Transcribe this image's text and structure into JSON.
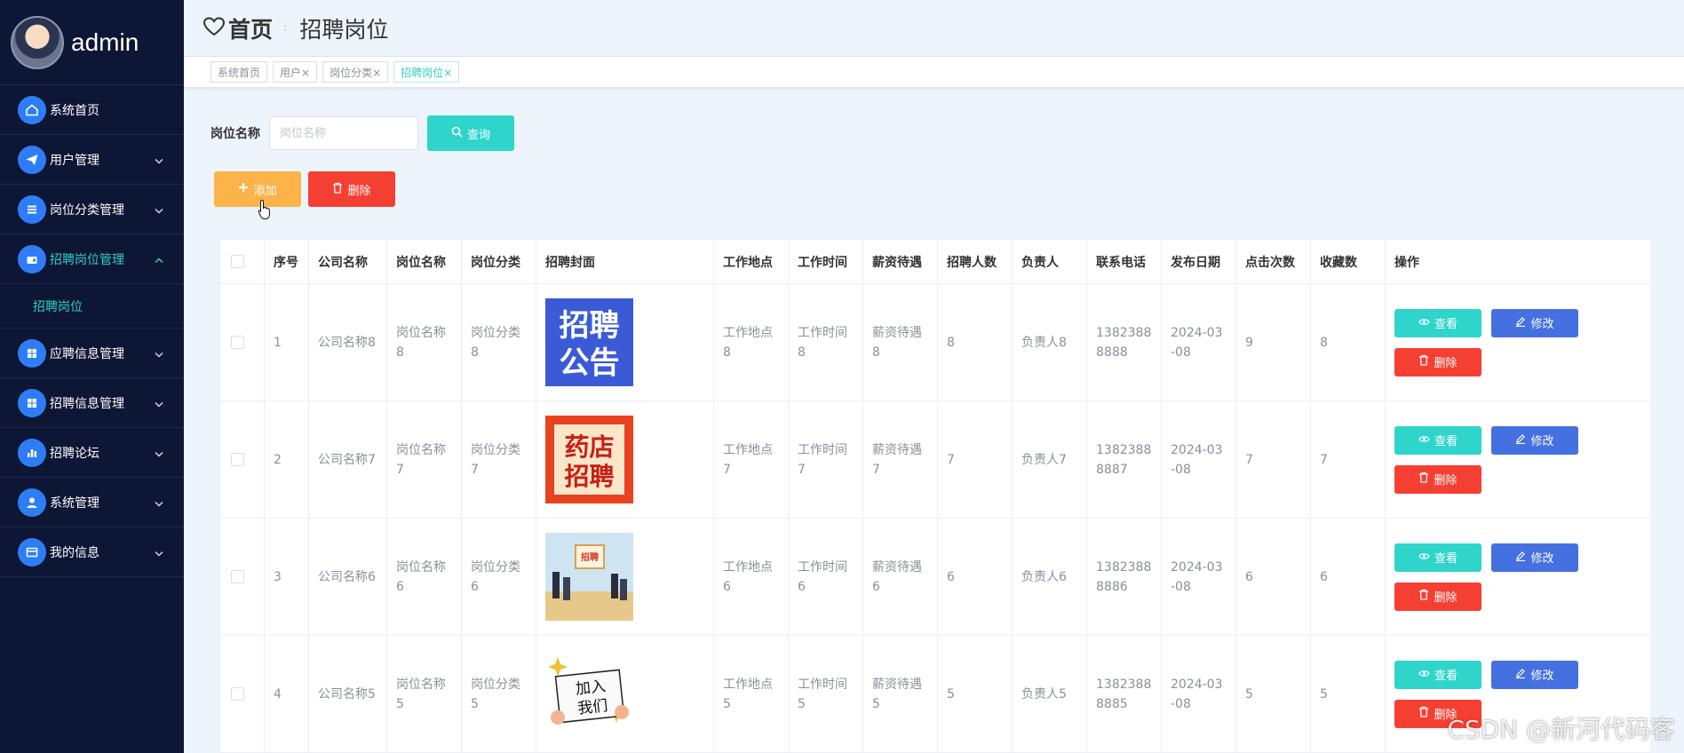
{
  "sidebar": {
    "username": "admin",
    "menu": [
      {
        "label": "系统首页",
        "icon": "home-icon"
      },
      {
        "label": "用户管理",
        "icon": "paper-plane-icon"
      },
      {
        "label": "岗位分类管理",
        "icon": "list-icon"
      },
      {
        "label": "招聘岗位管理",
        "icon": "wallet-icon"
      },
      {
        "label": "应聘信息管理",
        "icon": "grid-icon"
      },
      {
        "label": "招聘信息管理",
        "icon": "grid-icon"
      },
      {
        "label": "招聘论坛",
        "icon": "bar-chart-icon"
      },
      {
        "label": "系统管理",
        "icon": "user-icon"
      },
      {
        "label": "我的信息",
        "icon": "card-icon"
      }
    ],
    "submenu_item": "招聘岗位"
  },
  "header": {
    "home": "首页",
    "separator": ":",
    "title": "招聘岗位"
  },
  "tags": [
    {
      "label": "系统首页"
    },
    {
      "label": "用户×"
    },
    {
      "label": "岗位分类×"
    },
    {
      "label": "招聘岗位×"
    }
  ],
  "search": {
    "label": "岗位名称",
    "placeholder": "岗位名称",
    "query_button": "查询"
  },
  "actions": {
    "add": "添加",
    "delete": "删除"
  },
  "table": {
    "headers": [
      "序号",
      "公司名称",
      "岗位名称",
      "岗位分类",
      "招聘封面",
      "工作地点",
      "工作时间",
      "薪资待遇",
      "招聘人数",
      "负责人",
      "联系电话",
      "发布日期",
      "点击次数",
      "收藏数",
      "操作"
    ],
    "rows": [
      {
        "no": "1",
        "company": "公司名称8",
        "position": "岗位名称8",
        "category": "岗位分类8",
        "cover_text": [
          "招聘",
          "公告"
        ],
        "location": "工作地点8",
        "time": "工作时间8",
        "salary": "薪资待遇8",
        "count": "8",
        "manager": "负责人8",
        "phone": "13823888888",
        "date": "2024-03-08",
        "clicks": "9",
        "favorites": "8"
      },
      {
        "no": "2",
        "company": "公司名称7",
        "position": "岗位名称7",
        "category": "岗位分类7",
        "cover_text": [
          "药店",
          "招聘"
        ],
        "location": "工作地点7",
        "time": "工作时间7",
        "salary": "薪资待遇7",
        "count": "7",
        "manager": "负责人7",
        "phone": "13823888887",
        "date": "2024-03-08",
        "clicks": "7",
        "favorites": "7"
      },
      {
        "no": "3",
        "company": "公司名称6",
        "position": "岗位名称6",
        "category": "岗位分类6",
        "cover_text": [
          "招聘"
        ],
        "location": "工作地点6",
        "time": "工作时间6",
        "salary": "薪资待遇6",
        "count": "6",
        "manager": "负责人6",
        "phone": "13823888886",
        "date": "2024-03-08",
        "clicks": "6",
        "favorites": "6"
      },
      {
        "no": "4",
        "company": "公司名称5",
        "position": "岗位名称5",
        "category": "岗位分类5",
        "cover_text": [
          "加入",
          "我们"
        ],
        "location": "工作地点5",
        "time": "工作时间5",
        "salary": "薪资待遇5",
        "count": "5",
        "manager": "负责人5",
        "phone": "13823888885",
        "date": "2024-03-08",
        "clicks": "5",
        "favorites": "5"
      }
    ],
    "row_actions": {
      "view": "查看",
      "edit": "修改",
      "remove": "删除"
    }
  },
  "watermark": "CSDN @新河代码客",
  "colors": {
    "sidebar_bg": "#0d1635",
    "accent_teal": "#2fd5cb",
    "add_orange": "#fbb34a",
    "danger_red": "#f63f33",
    "edit_blue": "#4570e0",
    "menu_icon_blue": "#2f7df6"
  }
}
